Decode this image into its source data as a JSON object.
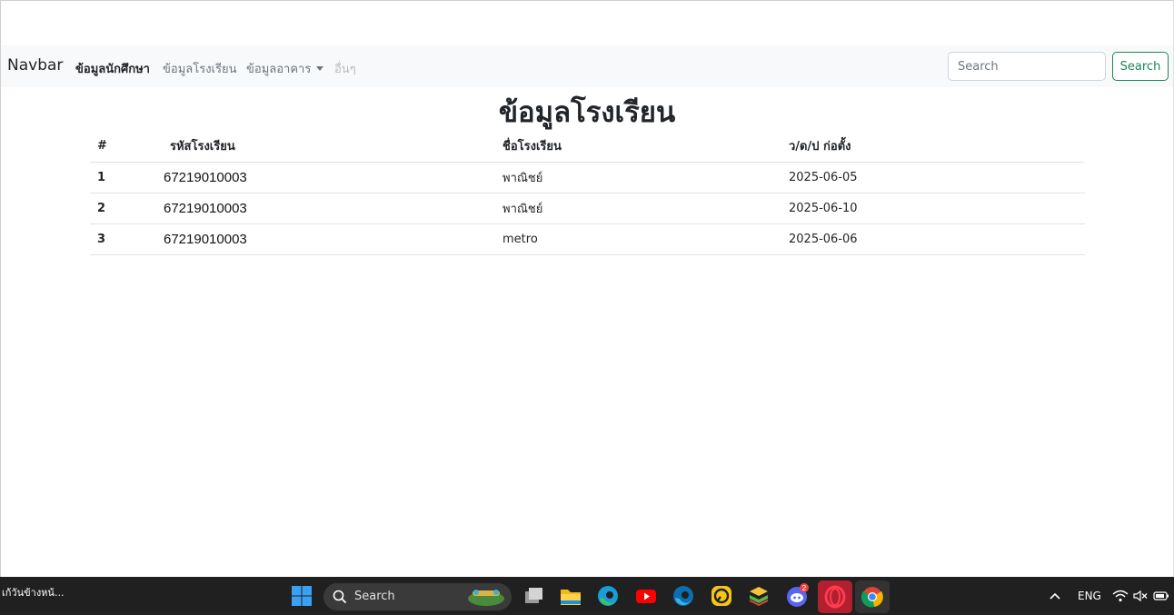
{
  "navbar": {
    "brand": "Navbar",
    "links": [
      "ข้อมูลนักศึกษา",
      "ข้อมูลโรงเรียน",
      "ข้อมูลอาคาร",
      "อื่นๆ"
    ],
    "search_placeholder": "Search",
    "search_button": "Search"
  },
  "main": {
    "title": "ข้อมูลโรงเรียน",
    "table": {
      "headers": [
        "#",
        "รหัสโรงเรียน",
        "ชื่อโรงเรียน",
        "ว/ด/ป ก่อตั้ง"
      ],
      "rows": [
        {
          "num": "1",
          "code": "67219010003",
          "name": "พาณิชย์",
          "date": "2025-06-05"
        },
        {
          "num": "2",
          "code": "67219010003",
          "name": "พาณิชย์",
          "date": "2025-06-10"
        },
        {
          "num": "3",
          "code": "67219010003",
          "name": "metro",
          "date": "2025-06-06"
        }
      ]
    }
  },
  "taskbar": {
    "news": "เก้วันข้างหน้...",
    "search_label": "Search",
    "discord_badge": "2",
    "language": "ENG",
    "icons": [
      "windows-start-icon",
      "search-icon",
      "task-view-icon",
      "file-explorer-icon",
      "edge-icon",
      "youtube-icon",
      "edge-dev-icon",
      "app-icon",
      "bluestacks-icon",
      "discord-icon",
      "opera-icon",
      "chrome-icon",
      "chevron-up-icon",
      "wifi-icon",
      "speaker-muted-icon",
      "battery-icon"
    ]
  }
}
